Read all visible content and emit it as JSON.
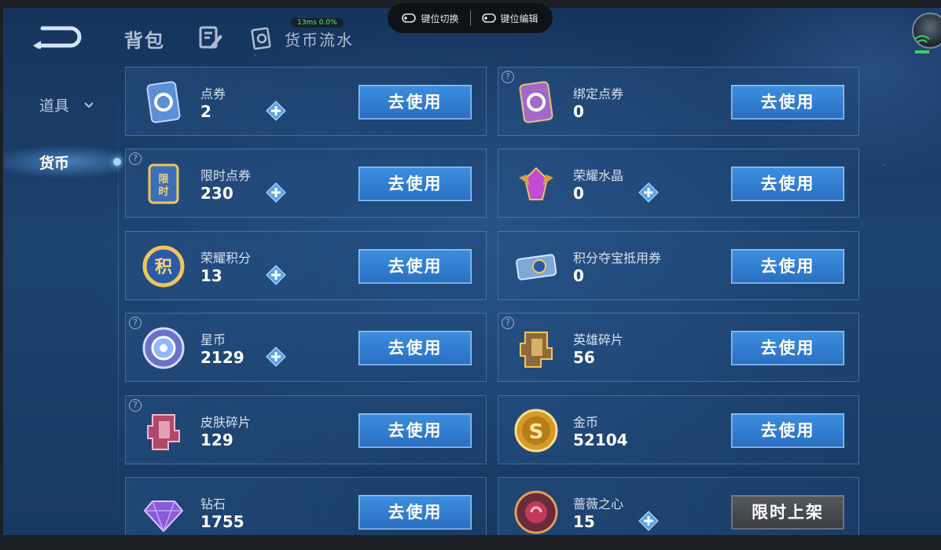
{
  "header": {
    "bag_label": "背包",
    "flow_label": "货币流水"
  },
  "overlay": {
    "perf": "13ms  0.0%",
    "keymap_switch": "键位切换",
    "keymap_edit": "键位编辑"
  },
  "sidebar": {
    "props_label": "道具",
    "currency_label": "货币"
  },
  "items": [
    {
      "name": "点券",
      "count": "2",
      "button": "去使用",
      "icon": "coupon-icon",
      "help": false,
      "plus": true
    },
    {
      "name": "绑定点券",
      "count": "0",
      "button": "去使用",
      "icon": "bound-coupon-icon",
      "help": true,
      "plus": false
    },
    {
      "name": "限时点券",
      "count": "230",
      "button": "去使用",
      "icon": "limited-coupon-icon",
      "help": true,
      "plus": true
    },
    {
      "name": "荣耀水晶",
      "count": "0",
      "button": "去使用",
      "icon": "glory-crystal-icon",
      "help": false,
      "plus": true
    },
    {
      "name": "荣耀积分",
      "count": "13",
      "button": "去使用",
      "icon": "glory-points-icon",
      "help": false,
      "plus": true
    },
    {
      "name": "积分夺宝抵用券",
      "count": "0",
      "button": "去使用",
      "icon": "treasure-voucher-icon",
      "help": false,
      "plus": false
    },
    {
      "name": "星币",
      "count": "2129",
      "button": "去使用",
      "icon": "star-coin-icon",
      "help": true,
      "plus": true
    },
    {
      "name": "英雄碎片",
      "count": "56",
      "button": "去使用",
      "icon": "hero-fragment-icon",
      "help": true,
      "plus": false
    },
    {
      "name": "皮肤碎片",
      "count": "129",
      "button": "去使用",
      "icon": "skin-fragment-icon",
      "help": true,
      "plus": false
    },
    {
      "name": "金币",
      "count": "52104",
      "button": "去使用",
      "icon": "gold-coin-icon",
      "help": false,
      "plus": false
    },
    {
      "name": "钻石",
      "count": "1755",
      "button": "去使用",
      "icon": "diamond-icon",
      "help": false,
      "plus": false
    },
    {
      "name": "蔷薇之心",
      "count": "15",
      "button": "限时上架",
      "icon": "rose-heart-icon",
      "help": false,
      "plus": true
    }
  ],
  "colors": {
    "button_blue": "#2a6fc2",
    "button_grey": "#3a3d42",
    "background": "#1d4370"
  }
}
